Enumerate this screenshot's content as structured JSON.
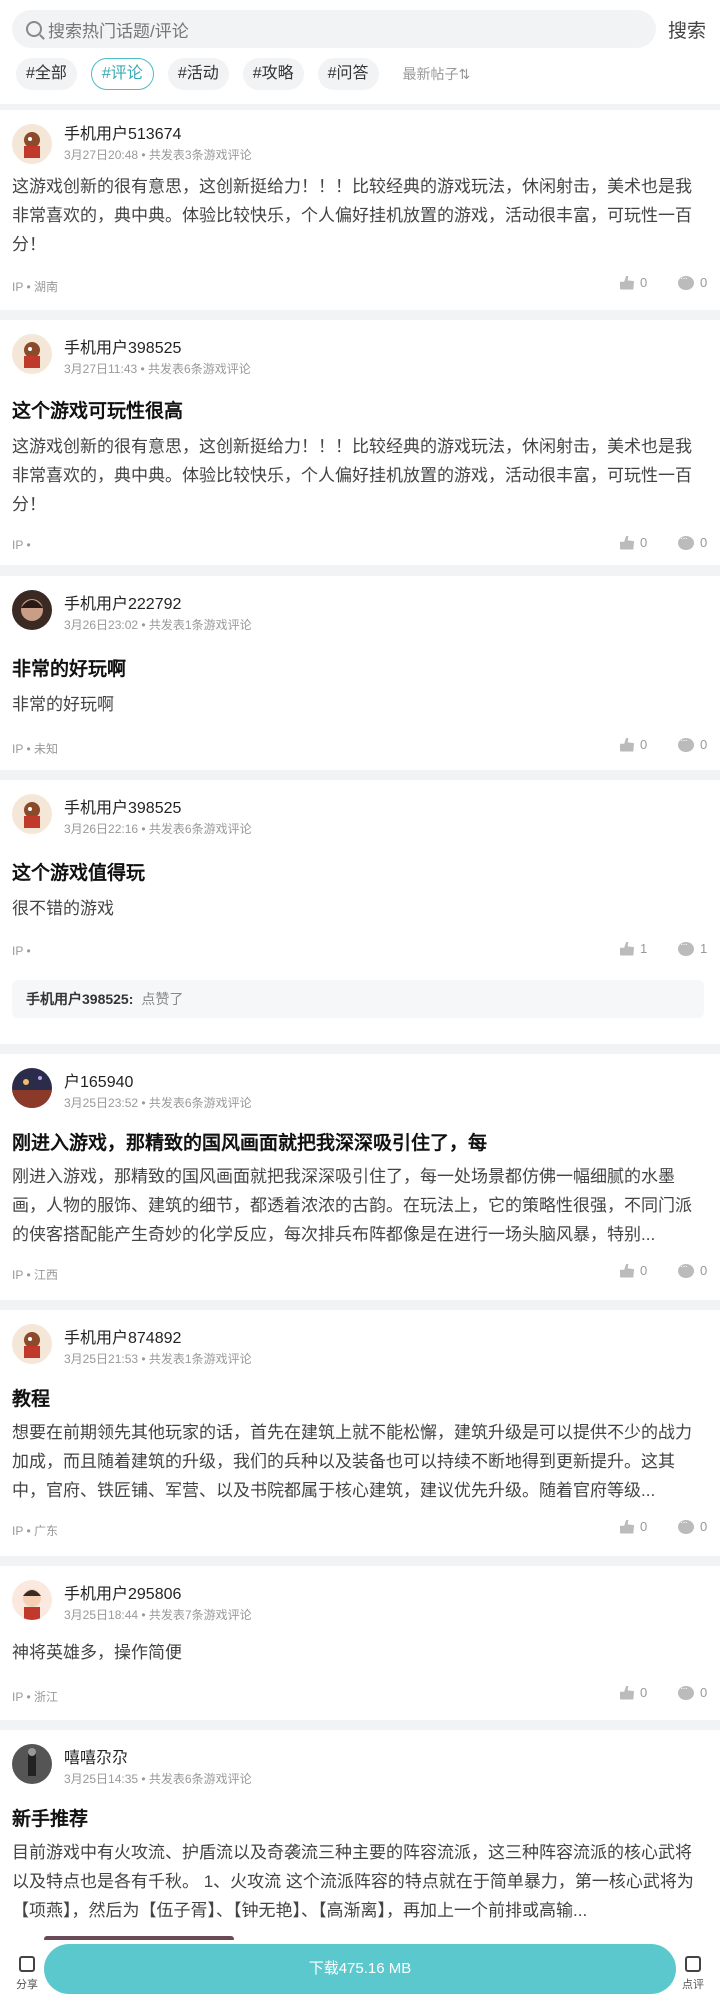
{
  "search": {
    "placeholder": "搜索热门话题/评论",
    "button": "搜索"
  },
  "tags": [
    "#全部",
    "#评论",
    "#活动",
    "#攻略",
    "#问答"
  ],
  "sort": "最新帖子⇅",
  "posts": [
    {
      "user": "手机用户513674",
      "meta": "3月27日20:48 • 共发表3条游戏评论",
      "title": "",
      "body": "这游戏创新的很有意思，这创新挺给力！！！比较经典的游戏玩法，休闲射击，美术也是我非常喜欢的，典中典。体验比较快乐，个人偏好挂机放置的游戏，活动很丰富，可玩性一百分！",
      "ip": "IP • 湖南",
      "likes": "0",
      "comments": "0"
    },
    {
      "user": "手机用户398525",
      "meta": "3月27日11:43 • 共发表6条游戏评论",
      "title": "这个游戏可玩性很高",
      "body": "这游戏创新的很有意思，这创新挺给力！！！比较经典的游戏玩法，休闲射击，美术也是我非常喜欢的，典中典。体验比较快乐，个人偏好挂机放置的游戏，活动很丰富，可玩性一百分！",
      "ip": "IP •",
      "likes": "0",
      "comments": "0"
    },
    {
      "user": "手机用户222792",
      "meta": "3月26日23:02 • 共发表1条游戏评论",
      "title": "非常的好玩啊",
      "body": "非常的好玩啊",
      "ip": "IP • 未知",
      "likes": "0",
      "comments": "0"
    },
    {
      "user": "手机用户398525",
      "meta": "3月26日22:16 • 共发表6条游戏评论",
      "title": "这个游戏值得玩",
      "body": "很不错的游戏",
      "ip": "IP •",
      "likes": "1",
      "comments": "1",
      "reply_user": "手机用户398525:",
      "reply_text": "点赞了"
    },
    {
      "user": "户165940",
      "meta": "3月25日23:52 • 共发表6条游戏评论",
      "title": "刚进入游戏，那精致的国风画面就把我深深吸引住了，每",
      "body": "刚进入游戏，那精致的国风画面就把我深深吸引住了，每一处场景都仿佛一幅细腻的水墨画，人物的服饰、建筑的细节，都透着浓浓的古韵。在玩法上，它的策略性很强，不同门派的侠客搭配能产生奇妙的化学反应，每次排兵布阵都像是在进行一场头脑风暴，特别...",
      "ip": "IP • 江西",
      "likes": "0",
      "comments": "0"
    },
    {
      "user": "手机用户874892",
      "meta": "3月25日21:53 • 共发表1条游戏评论",
      "title": "教程",
      "body": "想要在前期领先其他玩家的话，首先在建筑上就不能松懈，建筑升级是可以提供不少的战力加成，而且随着建筑的升级，我们的兵种以及装备也可以持续不断地得到更新提升。这其中，官府、铁匠铺、军营、以及书院都属于核心建筑，建议优先升级。随着官府等级...",
      "ip": "IP • 广东",
      "likes": "0",
      "comments": "0"
    },
    {
      "user": "手机用户295806",
      "meta": "3月25日18:44 • 共发表7条游戏评论",
      "title": "",
      "body": "神将英雄多，操作简便",
      "ip": "IP • 浙江",
      "likes": "0",
      "comments": "0"
    },
    {
      "user": "嘻嘻尕尕",
      "meta": "3月25日14:35 • 共发表6条游戏评论",
      "title": "新手推荐",
      "body": "目前游戏中有火攻流、护盾流以及奇袭流三种主要的阵容流派，这三种阵容流派的核心武将以及特点也是各有千秋。 1、火攻流 这个流派阵容的特点就在于简单暴力，第一核心武将为【项燕】，然后为【伍子胥】、【钟无艳】、【高渐离】，再加上一个前排或高输...",
      "ip": "",
      "likes": "",
      "comments": ""
    }
  ],
  "bottom": {
    "share": "分享",
    "download": "下载475.16 MB",
    "review": "点评"
  }
}
